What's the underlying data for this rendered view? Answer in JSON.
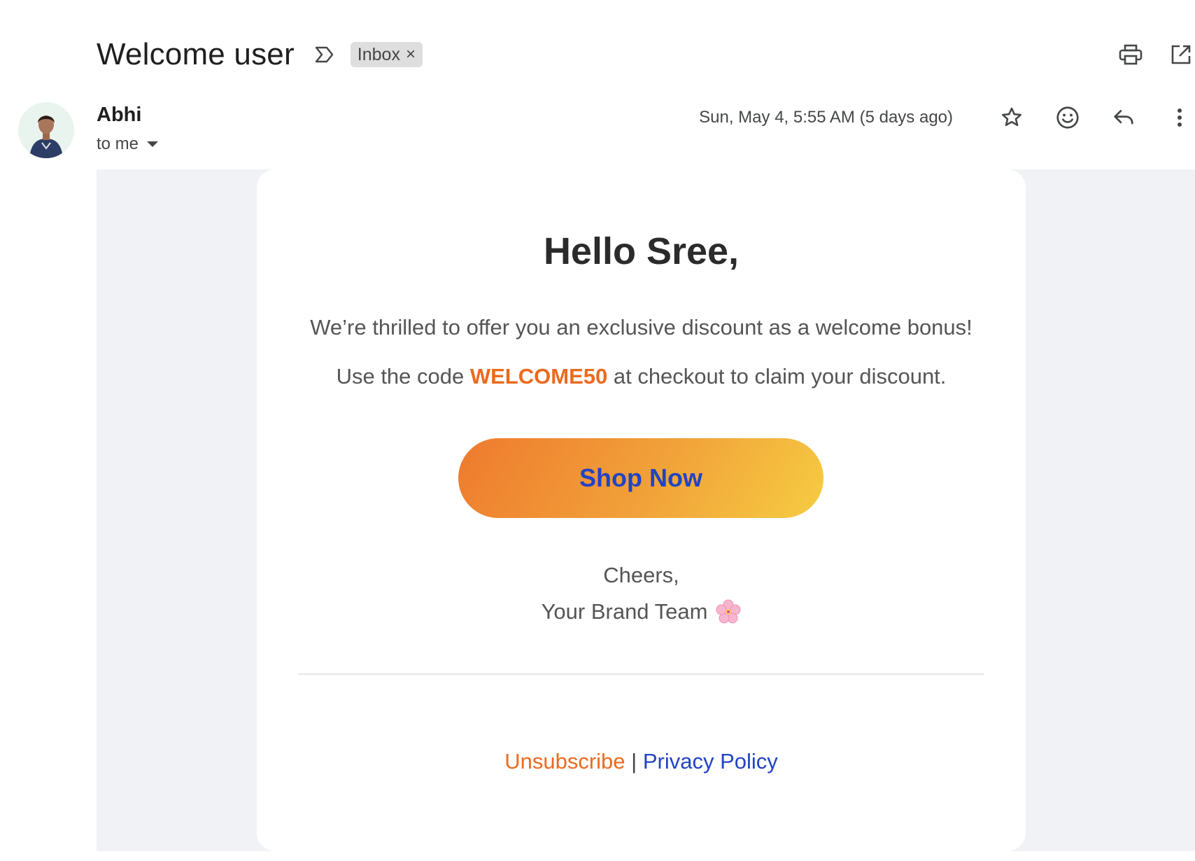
{
  "subject": "Welcome user",
  "label_chip": {
    "label": "Inbox",
    "close": "×"
  },
  "sender": {
    "name": "Abhi",
    "recipient": "to me"
  },
  "date": "Sun, May 4, 5:55 AM (5 days ago)",
  "icons": {
    "label": "label-arrow-icon",
    "print": "print-icon",
    "open_new": "open-in-new-window-icon",
    "star": "star-icon",
    "emoji": "emoji-reaction-icon",
    "reply": "reply-icon",
    "more": "more-vertical-icon",
    "flower": "cherry-blossom-icon"
  },
  "email": {
    "greeting": "Hello Sree,",
    "line1": "We’re thrilled to offer you an exclusive discount as a welcome bonus!",
    "line2_prefix": "Use the code ",
    "code": "WELCOME50",
    "line2_suffix": " at checkout to claim your discount.",
    "cta": "Shop Now",
    "signoff": "Cheers,",
    "team": "Your Brand Team",
    "footer": {
      "unsubscribe": "Unsubscribe",
      "separator": " | ",
      "privacy": "Privacy Policy"
    }
  },
  "colors": {
    "accent_orange": "#ec6a1e",
    "link_blue": "#2244c4",
    "button_gradient_start": "#ee7a2e",
    "button_gradient_end": "#f6cc42",
    "email_background": "#f1f2f6"
  }
}
